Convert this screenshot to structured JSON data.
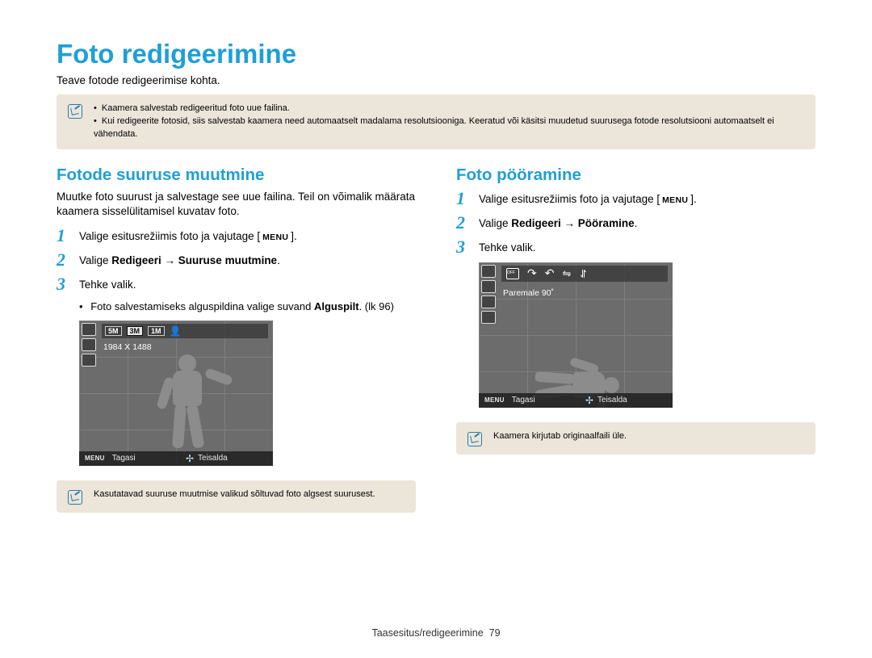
{
  "page_title": "Foto redigeerimine",
  "page_subtitle": "Teave fotode redigeerimise kohta.",
  "top_note": {
    "items": [
      "Kaamera salvestab redigeeritud foto uue failina.",
      "Kui redigeerite fotosid, siis salvestab kaamera need automaatselt madalama resolutsiooniga. Keeratud või käsitsi muudetud suurusega fotode resolutsiooni automaatselt ei vähendata."
    ]
  },
  "left": {
    "heading": "Fotode suuruse muutmine",
    "desc": "Muutke foto suurust ja salvestage see uue failina. Teil on võimalik määrata kaamera sisselülitamisel kuvatav foto.",
    "steps": {
      "s1_pre": "Valige esitusrežiimis foto ja vajutage [",
      "s1_chip": "MENU",
      "s1_post": "].",
      "s2_pre": "Valige ",
      "s2_bold": "Redigeeri → Suuruse muutmine",
      "s2_post": ".",
      "s3": "Tehke valik."
    },
    "sub_bullet_pre": "Foto salvestamiseks alguspildina valige suvand ",
    "sub_bullet_bold": "Alguspilt",
    "sub_bullet_post": ". (lk 96)",
    "lcd": {
      "chip1": "5M",
      "chip2": "3M",
      "chip3": "1M",
      "value": "1984 X 1488",
      "menu_chip": "MENU",
      "back_label": "Tagasi",
      "move_label": "Teisalda"
    },
    "bottom_note": "Kasutatavad suuruse muutmise valikud sõltuvad foto algsest suurusest."
  },
  "right": {
    "heading": "Foto pööramine",
    "steps": {
      "s1_pre": "Valige esitusrežiimis foto ja vajutage [",
      "s1_chip": "MENU",
      "s1_post": "].",
      "s2_pre": "Valige ",
      "s2_bold": "Redigeeri → Pööramine",
      "s2_post": ".",
      "s3": "Tehke valik."
    },
    "lcd": {
      "value": "Paremale 90˚",
      "menu_chip": "MENU",
      "back_label": "Tagasi",
      "move_label": "Teisalda"
    },
    "bottom_note": "Kaamera kirjutab originaalfaili üle."
  },
  "footer": {
    "section": "Taasesitus/redigeerimine",
    "page_num": "79"
  }
}
